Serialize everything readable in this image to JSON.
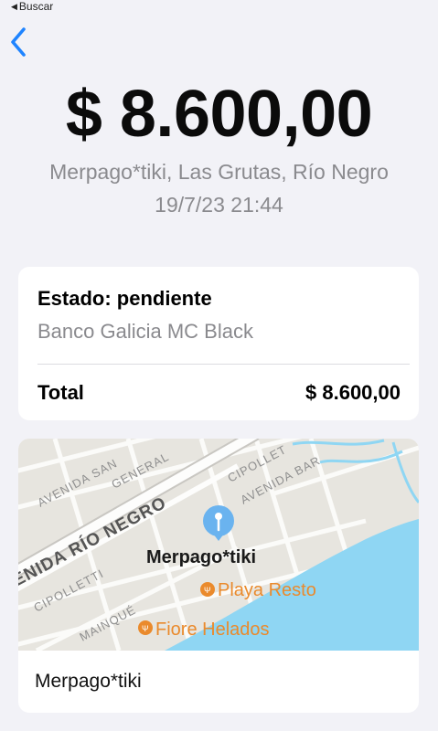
{
  "status_bar": {
    "back_label": "Buscar"
  },
  "header": {
    "amount": "$ 8.600,00",
    "merchant_location": "Merpago*tiki, Las Grutas, Río Negro",
    "datetime": "19/7/23 21:44"
  },
  "details": {
    "status": "Estado: pendiente",
    "card_name": "Banco Galicia MC Black",
    "total_label": "Total",
    "total_value": "$ 8.600,00"
  },
  "map": {
    "streets": [
      "AVENIDA SAN",
      "GENERAL",
      "CIPOLLET",
      "AVENIDA BAR",
      "AVENIDA RÍO NEGRO",
      "ENIDA RÍO NEGRO",
      "CIPOLLETTI",
      "MAINQUÉ"
    ],
    "pin_label": "Merpago*tiki",
    "poi": [
      {
        "name": "Playa Resto",
        "icon": "restaurant-icon"
      },
      {
        "name": "Fiore Helados",
        "icon": "restaurant-icon"
      }
    ],
    "colors": {
      "land": "#e7e5df",
      "water": "#8fd6f3",
      "poi": "#ea8a2c",
      "pin": "#6ab3ef"
    }
  },
  "merchant_caption": "Merpago*tiki"
}
